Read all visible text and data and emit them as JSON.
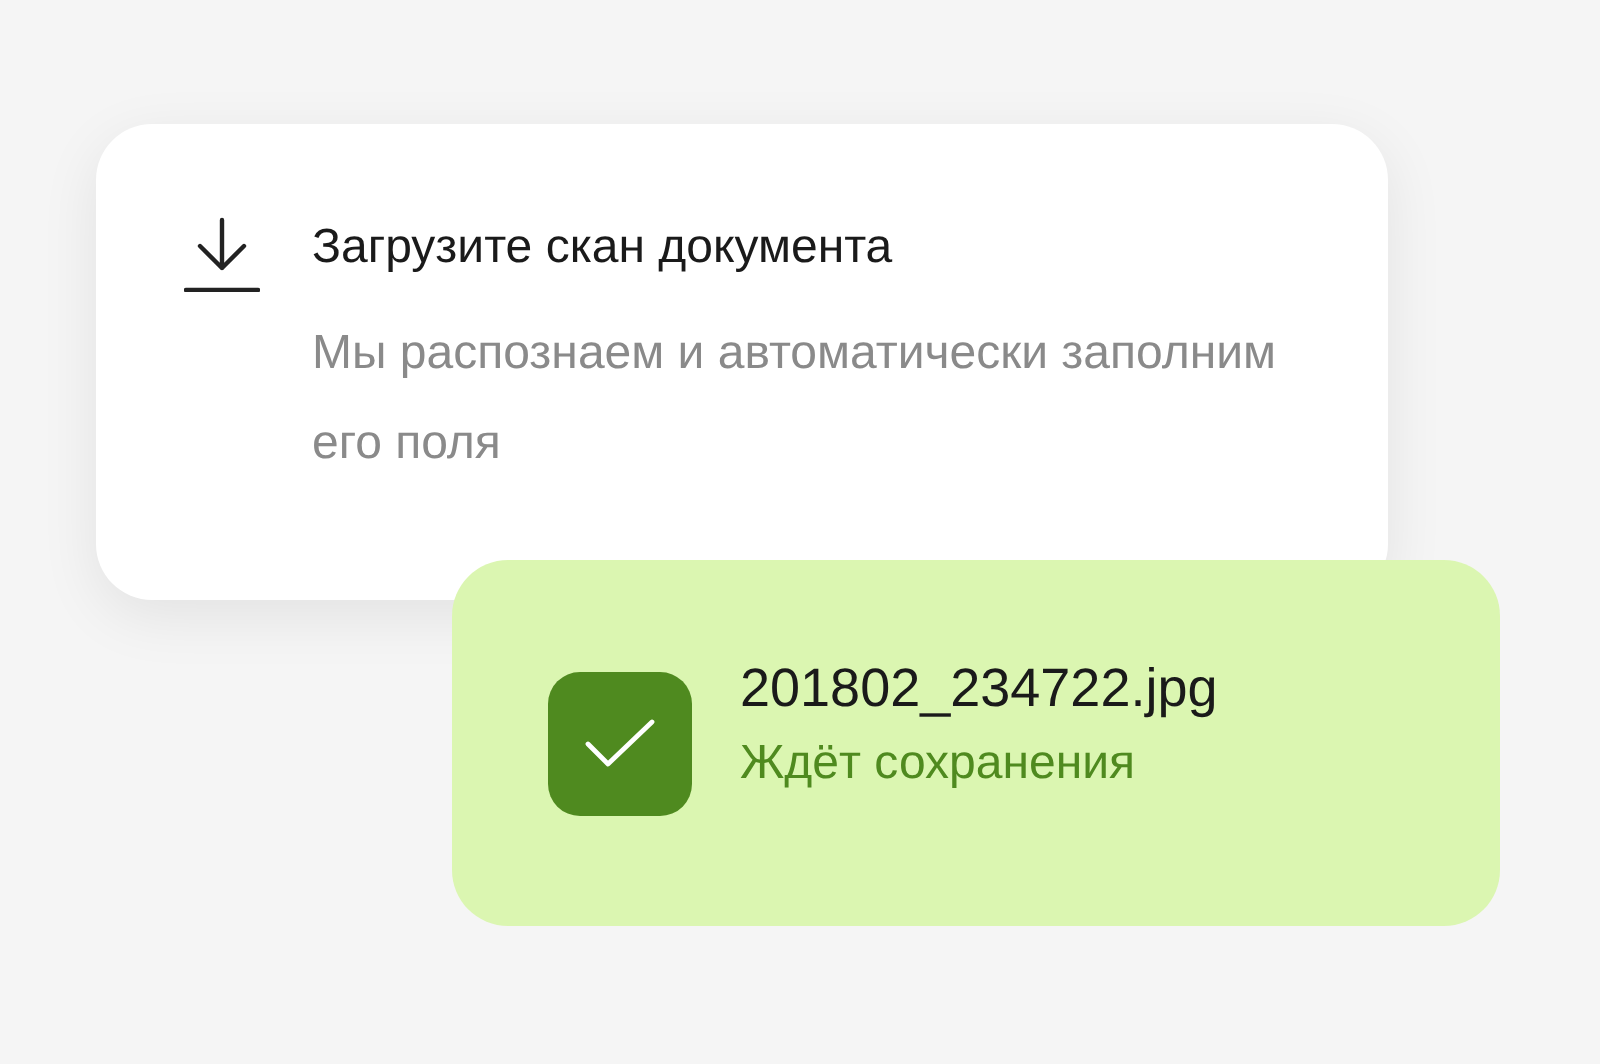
{
  "upload_card": {
    "title": "Загрузите скан документа",
    "description": "Мы распознаем и автоматически заполним его поля"
  },
  "file": {
    "name": "201802_234722.jpg",
    "status": "Ждёт сохранения",
    "checked": true
  }
}
